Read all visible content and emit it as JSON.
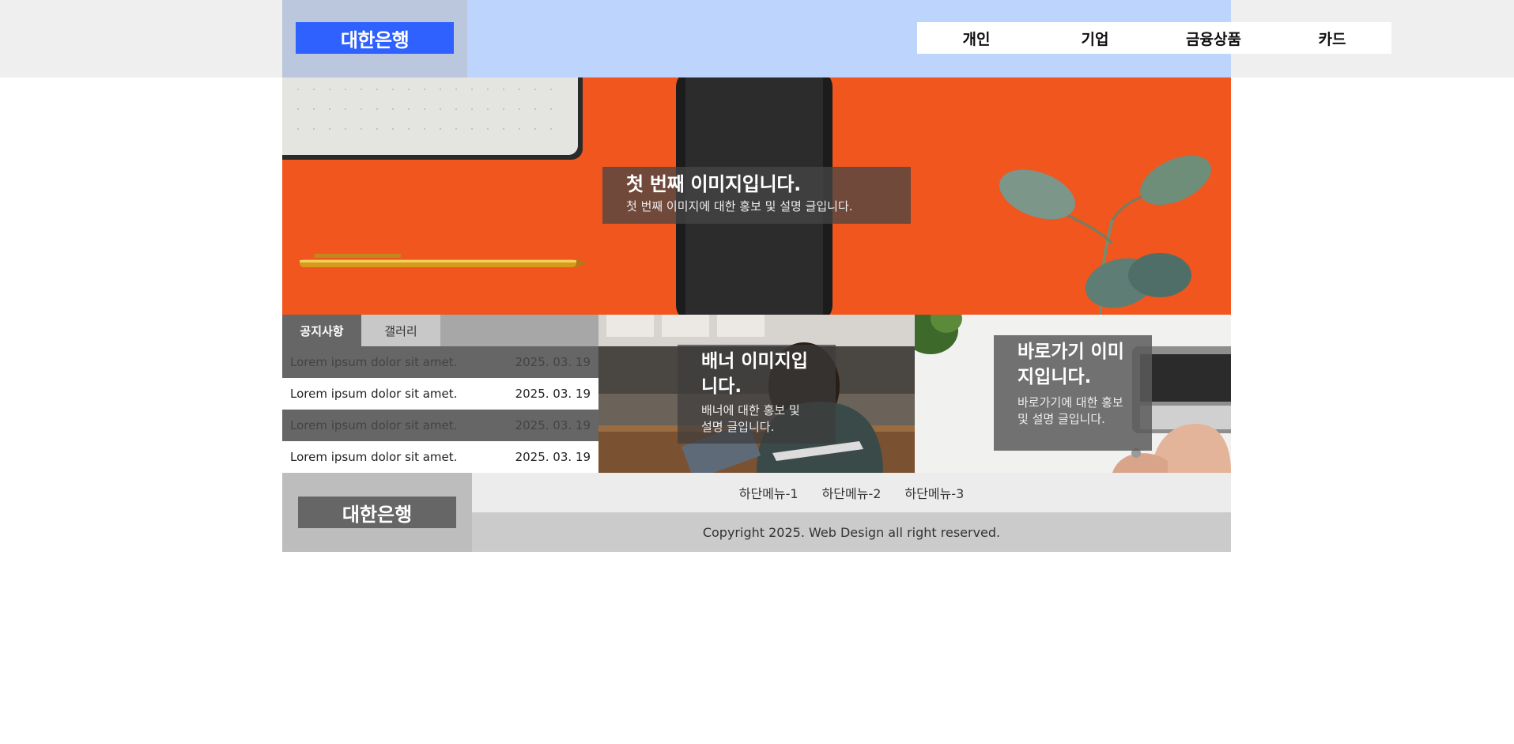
{
  "header": {
    "logo": "대한은행",
    "nav": [
      "개인",
      "기업",
      "금융상품",
      "카드"
    ]
  },
  "slider": {
    "title": "첫 번째 이미지입니다.",
    "description": "첫 번째 이미지에 대한 홍보 및 설명 글입니다."
  },
  "notice": {
    "tabs": [
      "공지사항",
      "갤러리"
    ],
    "items": [
      {
        "title": "Lorem ipsum dolor sit amet.",
        "date": "2025. 03. 19"
      },
      {
        "title": "Lorem ipsum dolor sit amet.",
        "date": "2025. 03. 19"
      },
      {
        "title": "Lorem ipsum dolor sit amet.",
        "date": "2025. 03. 19"
      },
      {
        "title": "Lorem ipsum dolor sit amet.",
        "date": "2025. 03. 19"
      }
    ]
  },
  "banner": {
    "title": "배너 이미지입니다.",
    "description": "배너에 대한 홍보 및 설명 글입니다."
  },
  "shortcut": {
    "title": "바로가기 이미지입니다.",
    "description": "바로가기에 대한 홍보 및 설명 글입니다."
  },
  "footer": {
    "logo": "대한은행",
    "menu": [
      "하단메뉴-1",
      "하단메뉴-2",
      "하단메뉴-3"
    ],
    "copyright": "Copyright 2025. Web Design all right reserved."
  },
  "colors": {
    "logo_bg": "#2f61ff",
    "header_bg": "#bdd5fd",
    "slide_bg": "#f0561e"
  }
}
